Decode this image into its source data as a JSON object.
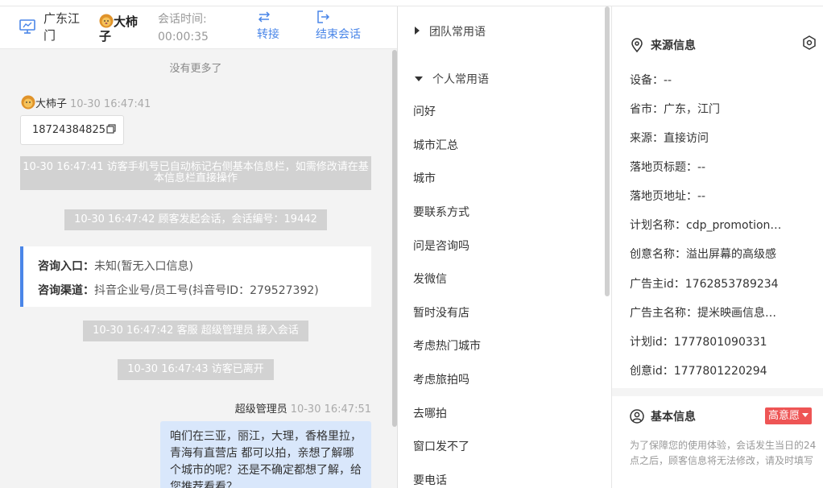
{
  "header": {
    "location": "广东江门",
    "visitor_name": "大柿子",
    "session_time_label": "会话时间:",
    "session_time": "00:00:35",
    "transfer_label": "转接",
    "end_label": "结束会话"
  },
  "chat": {
    "no_more": "没有更多了",
    "visitor_msg_name": "大柿子",
    "visitor_msg_time": "10-30 16:47:41",
    "phone": "18724384825",
    "sys_auto_mark": "10-30 16:47:41 访客手机号已自动标记右侧基本信息栏，如需修改请在基本信息栏直接操作",
    "sys_session_start": "10-30 16:47:42 顾客发起会话，会话编号：19442",
    "entry_label": "咨询入口：",
    "entry_value": "未知(暂无入口信息)",
    "channel_label": "咨询渠道：",
    "channel_value": "抖音企业号/员工号(抖音号ID：279527392)",
    "sys_agent_join": "10-30 16:47:42 客服 超级管理员 接入会话",
    "sys_visitor_left": "10-30 16:47:43 访客已离开",
    "agent_name": "超级管理员",
    "agent_time": "10-30 16:47:51",
    "agent_msg": "咱们在三亚，丽江，大理，香格里拉，青海有直营店 都可以拍，亲想了解哪个城市的呢？还是不确定都想了解，给您推荐看看？"
  },
  "phrases": {
    "team_group": "团队常用语",
    "personal_group": "个人常用语",
    "items": [
      "问好",
      "城市汇总",
      "城市",
      "要联系方式",
      "问是咨询吗",
      "发微信",
      "暂时没有店",
      "考虑热门城市",
      "考虑旅拍吗",
      "去哪拍",
      "窗口发不了",
      "要电话"
    ]
  },
  "source_info": {
    "title": "来源信息",
    "rows": [
      "设备：--",
      "省市：广东，江门",
      "来源：直接访问",
      "落地页标题：--",
      "落地页地址：--",
      "计划名称：cdp_promotion_ad",
      "创意名称：溢出屏幕的高级感",
      "广告主id：1762853789234",
      "广告主名称：提米映画信息技术",
      "计划id：1777801090331",
      "创意id：1777801220294"
    ]
  },
  "basic_info": {
    "title": "基本信息",
    "badge": "高意愿",
    "note": "为了保障您的使用体验，会话发生当日的24点之后，顾客信息将无法修改，请及时填写"
  },
  "colors": {
    "accent": "#4a86e8",
    "bubble": "#d9e7fb",
    "badge": "#e55555"
  }
}
